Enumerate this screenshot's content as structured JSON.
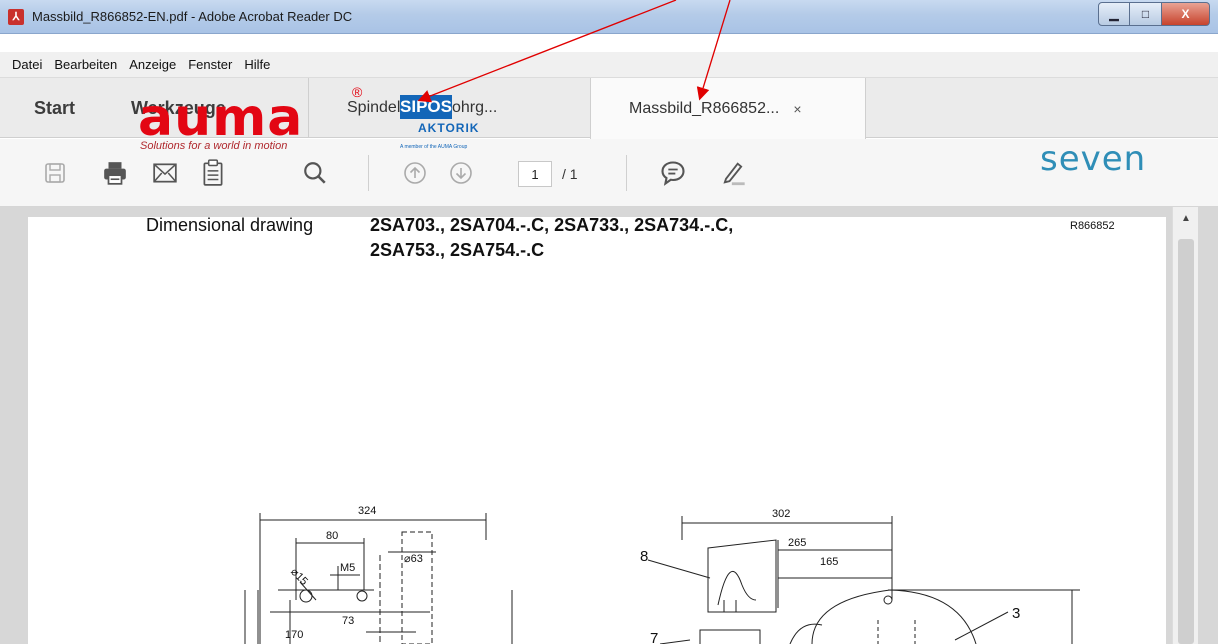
{
  "window": {
    "title": "Massbild_R866852-EN.pdf - Adobe Acrobat Reader DC",
    "app_icon": "acrobat-icon",
    "minimize_label": "▁",
    "maximize_label": "□",
    "close_label": "X"
  },
  "menu": [
    "Datei",
    "Bearbeiten",
    "Anzeige",
    "Fenster",
    "Hilfe"
  ],
  "tabs": {
    "start": "Start",
    "tools": "Werkzeuge",
    "documents": [
      {
        "label": "Spindelschutzrohrg...",
        "active": false
      },
      {
        "label": "Massbild_R866852...",
        "active": true
      }
    ],
    "close_symbol": "×"
  },
  "toolbar": {
    "icons": [
      "save-icon",
      "print-icon",
      "email-icon",
      "clipboard-icon",
      "search-icon",
      "page-up-icon",
      "page-down-icon",
      "comment-icon",
      "highlight-pen-icon"
    ],
    "page_current": "1",
    "page_total": "/ 1"
  },
  "document": {
    "logo_auma": "auma",
    "logo_auma_reg": "®",
    "logo_auma_tagline": "Solutions for a world in motion",
    "logo_sipos": "SIPOS",
    "logo_sipos_sub": "AKTORIK",
    "logo_sipos_member": "A member of the AUMA Group",
    "logo_seven": "seven",
    "heading_label": "Dimensional drawing",
    "heading_models_line1": "2SA703., 2SA704.-.C, 2SA733., 2SA734.-.C,",
    "heading_models_line2": "2SA753., 2SA754.-.C",
    "reference": "R866852",
    "left_dims": {
      "d324": "324",
      "d80": "80",
      "d63": "⌀63",
      "m5": "M5",
      "d15": "⌀15",
      "d73": "73",
      "d170": "170"
    },
    "right_dims": {
      "d302": "302",
      "d265": "265",
      "d165": "165",
      "n8": "8",
      "n3": "3",
      "n7": "7"
    }
  },
  "colors": {
    "titlebar": "#b4cbe8",
    "auma_red": "#e30613",
    "sipos_blue": "#1366b8",
    "seven_blue": "#2f8eb7",
    "annotation_arrow": "#e00000"
  }
}
